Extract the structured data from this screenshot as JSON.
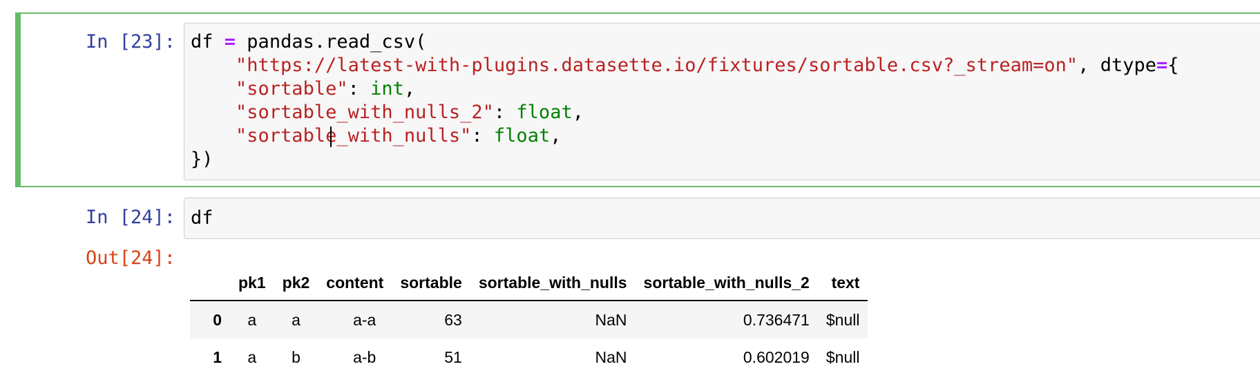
{
  "cells": [
    {
      "prompt": "In [23]:",
      "code_lines": [
        [
          "df ",
          "=",
          " pandas.read_csv("
        ],
        [
          "    ",
          "\"https://latest-with-plugins.datasette.io/fixtures/sortable.csv?_stream=on\"",
          ", dtype",
          "=",
          "{"
        ],
        [
          "    ",
          "\"sortable\"",
          ": ",
          "int",
          ","
        ],
        [
          "    ",
          "\"sortable_with_nulls_2\"",
          ": ",
          "float",
          ","
        ],
        [
          "    ",
          "\"sortable_with_nulls\"",
          ": ",
          "float",
          ","
        ],
        [
          "})"
        ]
      ]
    },
    {
      "prompt": "In [24]:",
      "code": "df",
      "output_prompt": "Out[24]:"
    }
  ],
  "table": {
    "columns": [
      "",
      "pk1",
      "pk2",
      "content",
      "sortable",
      "sortable_with_nulls",
      "sortable_with_nulls_2",
      "text"
    ],
    "rows": [
      [
        "0",
        "a",
        "a",
        "a-a",
        "63",
        "NaN",
        "0.736471",
        "$null"
      ],
      [
        "1",
        "a",
        "b",
        "a-b",
        "51",
        "NaN",
        "0.602019",
        "$null"
      ]
    ]
  },
  "colors": {
    "selected_border": "#66bb6a",
    "in_prompt": "#303f9f",
    "out_prompt": "#d84315",
    "string": "#ba2121",
    "builtin": "#008000",
    "operator": "#aa22ff"
  }
}
